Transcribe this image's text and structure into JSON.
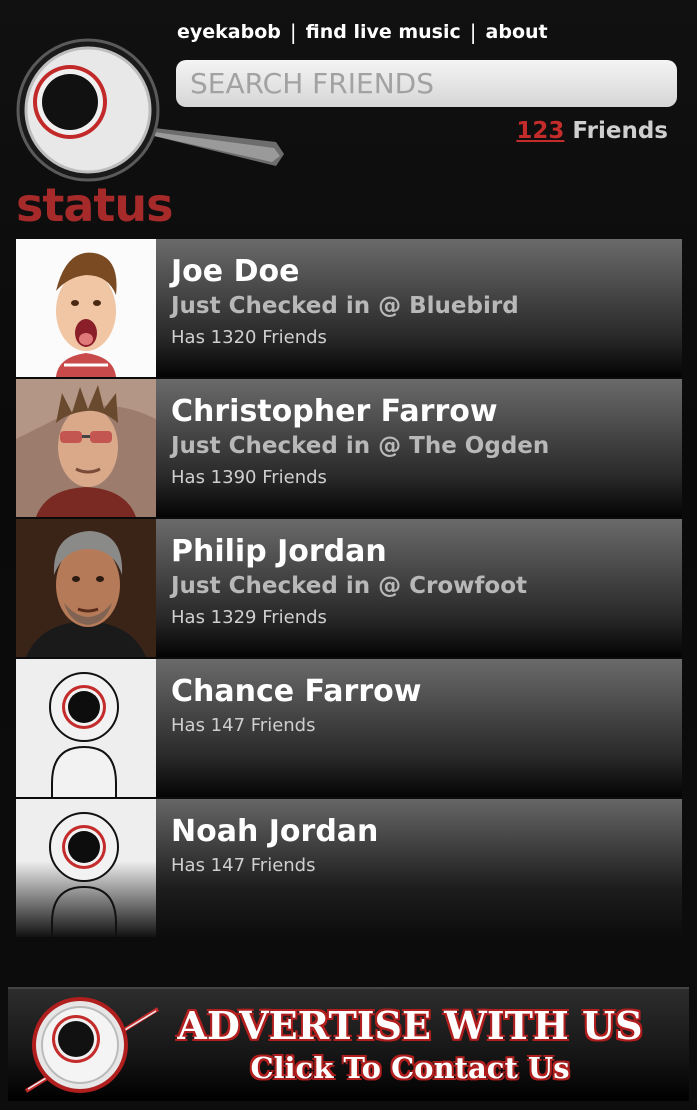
{
  "nav": {
    "items": [
      "eyekabob",
      "find live music",
      "about"
    ],
    "separator": "|"
  },
  "search": {
    "placeholder": "SEARCH FRIENDS"
  },
  "friends_summary": {
    "count": "123",
    "label": "Friends"
  },
  "section": {
    "title": "status"
  },
  "friends": [
    {
      "name": "Joe Doe",
      "checkin": "Just Checked in @ Bluebird",
      "friends": "Has 1320 Friends",
      "avatar": "photo-kid"
    },
    {
      "name": "Christopher Farrow",
      "checkin": "Just Checked in @ The Ogden",
      "friends": "Has 1390 Friends",
      "avatar": "photo-man-sunglasses"
    },
    {
      "name": "Philip Jordan",
      "checkin": "Just Checked in @ Crowfoot",
      "friends": "Has 1329 Friends",
      "avatar": "photo-man-gray-hair"
    },
    {
      "name": "Chance Farrow",
      "checkin": "",
      "friends": "Has 147 Friends",
      "avatar": "default-avatar-icon"
    },
    {
      "name": "Noah Jordan",
      "checkin": "",
      "friends": "Has 147 Friends",
      "avatar": "default-avatar-icon"
    }
  ],
  "ad": {
    "title": "ADVERTISE WITH US",
    "subtitle": "Click To Contact Us"
  },
  "colors": {
    "accent": "#a72a2a",
    "count_link": "#c42b2b",
    "background": "#0c0c0c"
  }
}
